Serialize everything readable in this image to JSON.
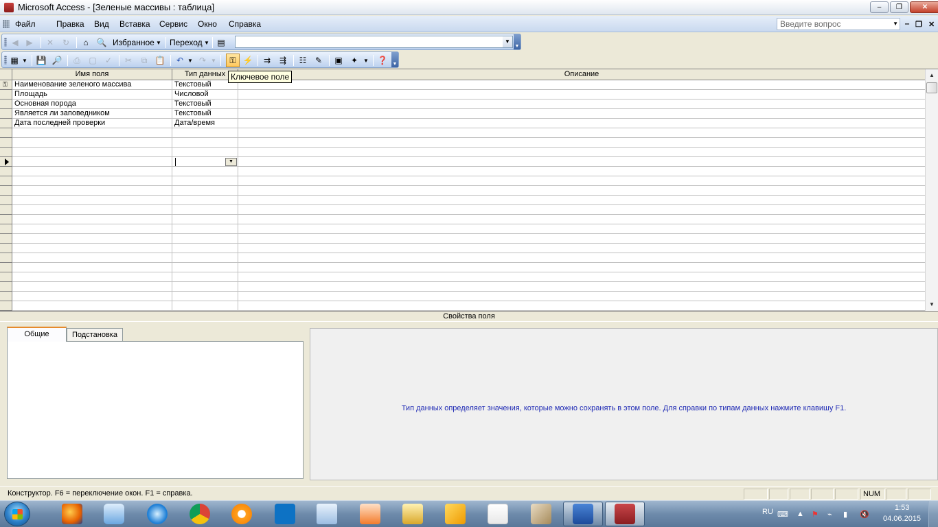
{
  "window": {
    "title": "Microsoft Access - [Зеленые массивы : таблица]",
    "minimize": "–",
    "maximize": "❐",
    "close": "✕"
  },
  "menu": {
    "items": [
      "Файл",
      "Правка",
      "Вид",
      "Вставка",
      "Сервис",
      "Окно",
      "Справка"
    ],
    "question_placeholder": "Введите вопрос",
    "mdi_minimize": "‒",
    "mdi_restore": "❐",
    "mdi_close": "✕"
  },
  "web_toolbar": {
    "favorites": "Избранное",
    "go": "Переход",
    "address": ""
  },
  "tooltip": "Ключевое поле",
  "grid": {
    "headers": {
      "name": "Имя поля",
      "type": "Тип данных",
      "description": "Описание"
    },
    "rows": [
      {
        "name": "Наименование зеленого массива",
        "type": "Текстовый",
        "description": "",
        "key": true
      },
      {
        "name": "Площадь",
        "type": "Числовой",
        "description": ""
      },
      {
        "name": "Основная порода",
        "type": "Текстовый",
        "description": ""
      },
      {
        "name": "Является ли заповедником",
        "type": "Текстовый",
        "description": ""
      },
      {
        "name": "Дата последней проверки",
        "type": "Дата/время",
        "description": ""
      }
    ],
    "current_row_index": 8
  },
  "properties": {
    "title": "Свойства поля",
    "tabs": [
      "Общие",
      "Подстановка"
    ],
    "help_text": "Тип данных определяет значения, которые можно сохранять в этом поле.  Для справки по типам данных нажмите клавишу F1."
  },
  "status": {
    "text": "Конструктор.  F6 = переключение окон.  F1 = справка.",
    "num": "NUM"
  },
  "tray": {
    "lang": "RU",
    "time": "1:53",
    "date": "04.06.2015"
  }
}
